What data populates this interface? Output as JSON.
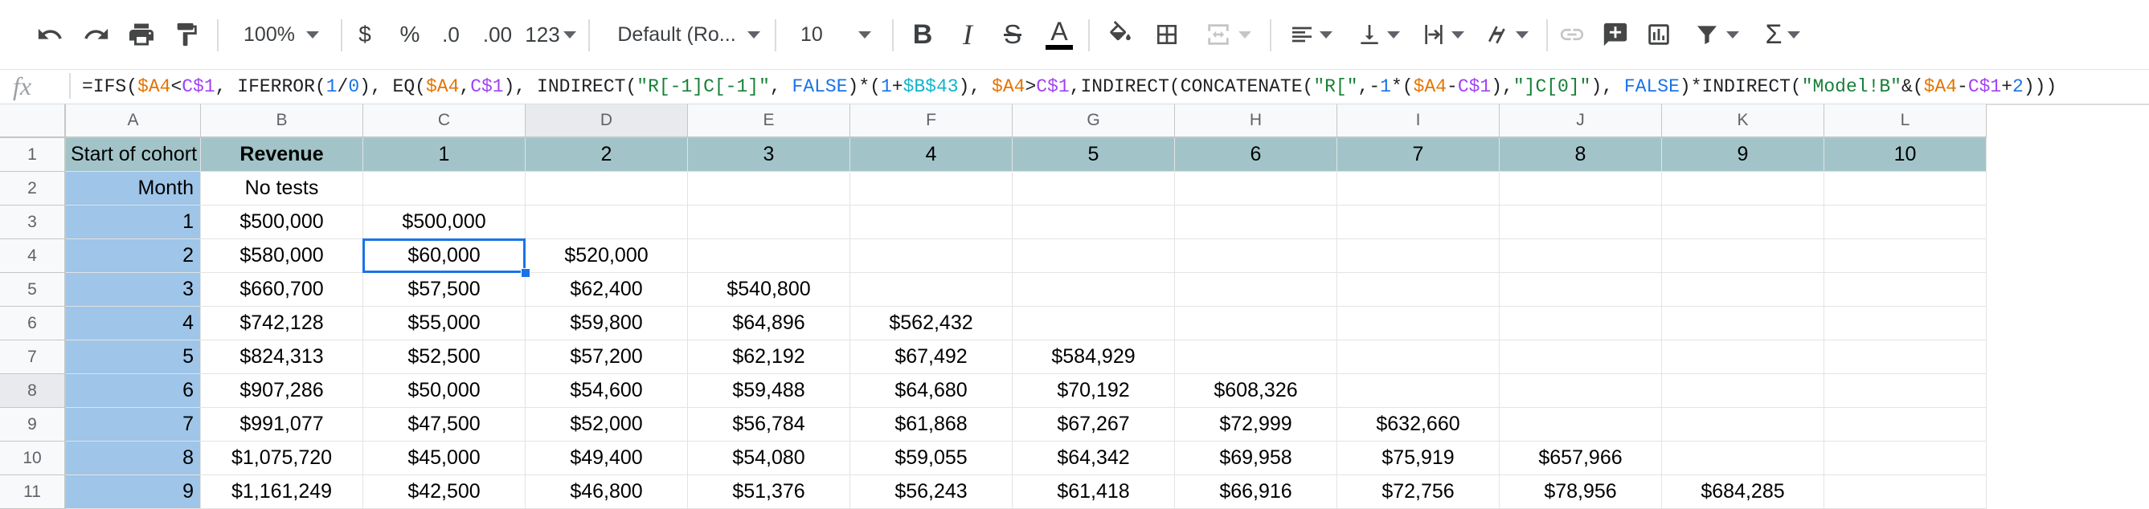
{
  "toolbar": {
    "zoom": "100%",
    "currency": "$",
    "percent": "%",
    "decrease_decimals": ".0",
    "increase_decimals": ".00",
    "more_formats": "123",
    "font_family": "Default (Ro...",
    "font_size": "10",
    "bold": "B",
    "italic": "I",
    "strikethrough": "S",
    "text_color": "A",
    "functions": "Σ",
    "icons": [
      "undo-icon",
      "redo-icon",
      "print-icon",
      "paint-format-icon",
      "fill-color-icon",
      "borders-icon",
      "merge-cells-icon",
      "align-icon",
      "vertical-align-icon",
      "text-wrap-icon",
      "text-rotation-icon",
      "link-icon",
      "comment-icon",
      "chart-icon",
      "filter-icon"
    ],
    "text_color_swatch": "#000000"
  },
  "formula_bar": {
    "fx_label": "fx",
    "formula_tokens": [
      {
        "t": "=IFS(",
        "c": ""
      },
      {
        "t": "$A4",
        "c": "ref1"
      },
      {
        "t": "<",
        "c": ""
      },
      {
        "t": "C$1",
        "c": "ref2"
      },
      {
        "t": ", IFERROR(",
        "c": ""
      },
      {
        "t": "1",
        "c": "num"
      },
      {
        "t": "/",
        "c": ""
      },
      {
        "t": "0",
        "c": "num"
      },
      {
        "t": "), EQ(",
        "c": ""
      },
      {
        "t": "$A4",
        "c": "ref1"
      },
      {
        "t": ",",
        "c": ""
      },
      {
        "t": "C$1",
        "c": "ref2"
      },
      {
        "t": "), INDIRECT(",
        "c": ""
      },
      {
        "t": "\"R[-1]C[-1]\"",
        "c": "str"
      },
      {
        "t": ", ",
        "c": ""
      },
      {
        "t": "FALSE",
        "c": "num"
      },
      {
        "t": ")*(",
        "c": ""
      },
      {
        "t": "1",
        "c": "num"
      },
      {
        "t": "+",
        "c": ""
      },
      {
        "t": "$B$43",
        "c": "ref3"
      },
      {
        "t": "), ",
        "c": ""
      },
      {
        "t": "$A4",
        "c": "ref1"
      },
      {
        "t": ">",
        "c": ""
      },
      {
        "t": "C$1",
        "c": "ref2"
      },
      {
        "t": ",INDIRECT(CONCATENATE(",
        "c": ""
      },
      {
        "t": "\"R[\"",
        "c": "str"
      },
      {
        "t": ",-",
        "c": ""
      },
      {
        "t": "1",
        "c": "num"
      },
      {
        "t": "*(",
        "c": ""
      },
      {
        "t": "$A4",
        "c": "ref1"
      },
      {
        "t": "-",
        "c": ""
      },
      {
        "t": "C$1",
        "c": "ref2"
      },
      {
        "t": "),",
        "c": ""
      },
      {
        "t": "\"]C[0]\"",
        "c": "str"
      },
      {
        "t": "), ",
        "c": ""
      },
      {
        "t": "FALSE",
        "c": "num"
      },
      {
        "t": ")*INDIRECT(",
        "c": ""
      },
      {
        "t": "\"Model!B\"",
        "c": "str"
      },
      {
        "t": "&(",
        "c": ""
      },
      {
        "t": "$A4",
        "c": "ref1"
      },
      {
        "t": "-",
        "c": ""
      },
      {
        "t": "C$1",
        "c": "ref2"
      },
      {
        "t": "+",
        "c": ""
      },
      {
        "t": "2",
        "c": "num"
      },
      {
        "t": ")))",
        "c": ""
      }
    ]
  },
  "sheet": {
    "columns": [
      "A",
      "B",
      "C",
      "D",
      "E",
      "F",
      "G",
      "H",
      "I",
      "J",
      "K",
      "L"
    ],
    "selected_column": "D",
    "rows": [
      {
        "n": "1",
        "cells": [
          "Start of cohort",
          "Revenue",
          "1",
          "2",
          "3",
          "4",
          "5",
          "6",
          "7",
          "8",
          "9",
          "10"
        ]
      },
      {
        "n": "2",
        "cells": [
          "Month",
          "No tests",
          "",
          "",
          "",
          "",
          "",
          "",
          "",
          "",
          "",
          ""
        ]
      },
      {
        "n": "3",
        "cells": [
          "1",
          "$500,000",
          "$500,000",
          "",
          "",
          "",
          "",
          "",
          "",
          "",
          "",
          ""
        ]
      },
      {
        "n": "4",
        "cells": [
          "2",
          "$580,000",
          "$60,000",
          "$520,000",
          "",
          "",
          "",
          "",
          "",
          "",
          "",
          ""
        ]
      },
      {
        "n": "5",
        "cells": [
          "3",
          "$660,700",
          "$57,500",
          "$62,400",
          "$540,800",
          "",
          "",
          "",
          "",
          "",
          "",
          ""
        ]
      },
      {
        "n": "6",
        "cells": [
          "4",
          "$742,128",
          "$55,000",
          "$59,800",
          "$64,896",
          "$562,432",
          "",
          "",
          "",
          "",
          "",
          ""
        ]
      },
      {
        "n": "7",
        "cells": [
          "5",
          "$824,313",
          "$52,500",
          "$57,200",
          "$62,192",
          "$67,492",
          "$584,929",
          "",
          "",
          "",
          "",
          ""
        ]
      },
      {
        "n": "8",
        "cells": [
          "6",
          "$907,286",
          "$50,000",
          "$54,600",
          "$59,488",
          "$64,680",
          "$70,192",
          "$608,326",
          "",
          "",
          "",
          ""
        ]
      },
      {
        "n": "9",
        "cells": [
          "7",
          "$991,077",
          "$47,500",
          "$52,000",
          "$56,784",
          "$61,868",
          "$67,267",
          "$72,999",
          "$632,660",
          "",
          "",
          ""
        ]
      },
      {
        "n": "10",
        "cells": [
          "8",
          "$1,075,720",
          "$45,000",
          "$49,400",
          "$54,080",
          "$59,055",
          "$64,342",
          "$69,958",
          "$75,919",
          "$657,966",
          "",
          ""
        ]
      },
      {
        "n": "11",
        "cells": [
          "9",
          "$1,161,249",
          "$42,500",
          "$46,800",
          "$51,376",
          "$56,243",
          "$61,418",
          "$66,916",
          "$72,756",
          "$78,956",
          "$684,285",
          ""
        ]
      }
    ],
    "selected_row": "8",
    "active_cell": "C4",
    "colors": {
      "header_band": "#a2c4c9",
      "label_column": "#9fc5e8",
      "selection": "#1a73e8"
    }
  }
}
